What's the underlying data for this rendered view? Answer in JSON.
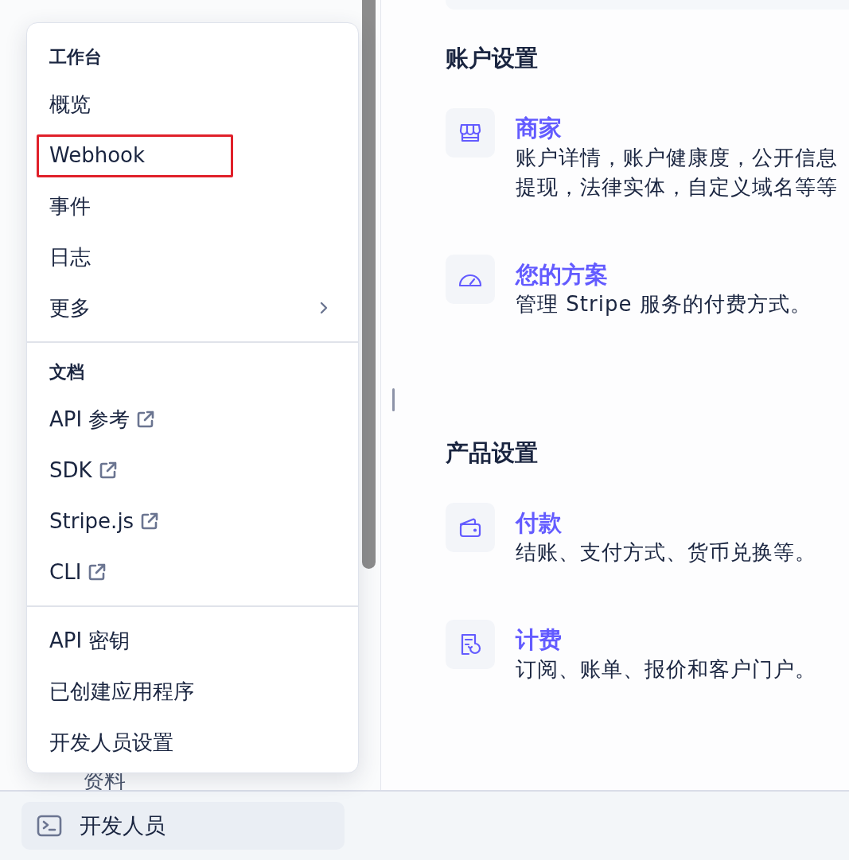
{
  "sidebar": {
    "hidden_item": "资料",
    "footer_button": {
      "label": "开发人员"
    }
  },
  "menu": {
    "sections": [
      {
        "heading": "工作台",
        "items": [
          {
            "label": "概览",
            "kind": "item",
            "highlighted": false
          },
          {
            "label": "Webhook",
            "kind": "item",
            "highlighted": true
          },
          {
            "label": "事件",
            "kind": "item",
            "highlighted": false
          },
          {
            "label": "日志",
            "kind": "item",
            "highlighted": false
          },
          {
            "label": "更多",
            "kind": "submenu",
            "highlighted": false
          }
        ]
      },
      {
        "heading": "文档",
        "items": [
          {
            "label": "API 参考",
            "kind": "external",
            "highlighted": false
          },
          {
            "label": "SDK",
            "kind": "external",
            "highlighted": false
          },
          {
            "label": "Stripe.js",
            "kind": "external",
            "highlighted": false
          },
          {
            "label": "CLI",
            "kind": "external",
            "highlighted": false
          }
        ]
      },
      {
        "items": [
          {
            "label": "API 密钥",
            "kind": "item",
            "highlighted": false
          },
          {
            "label": "已创建应用程序",
            "kind": "item",
            "highlighted": false
          },
          {
            "label": "开发人员设置",
            "kind": "item",
            "highlighted": false
          }
        ]
      }
    ]
  },
  "main": {
    "sections": [
      {
        "title": "账户设置",
        "items": [
          {
            "title": "商家",
            "description": [
              "账户详情，账户健康度，公开信息",
              "提现，法律实体，自定义域名等等"
            ]
          },
          {
            "title": "您的方案",
            "description": [
              "管理 Stripe 服务的付费方式。"
            ]
          }
        ]
      },
      {
        "title": "产品设置",
        "items": [
          {
            "title": "付款",
            "description": [
              "结账、支付方式、货币兑换等。"
            ]
          },
          {
            "title": "计费",
            "description": [
              "订阅、账单、报价和客户门户。"
            ]
          }
        ]
      }
    ]
  }
}
